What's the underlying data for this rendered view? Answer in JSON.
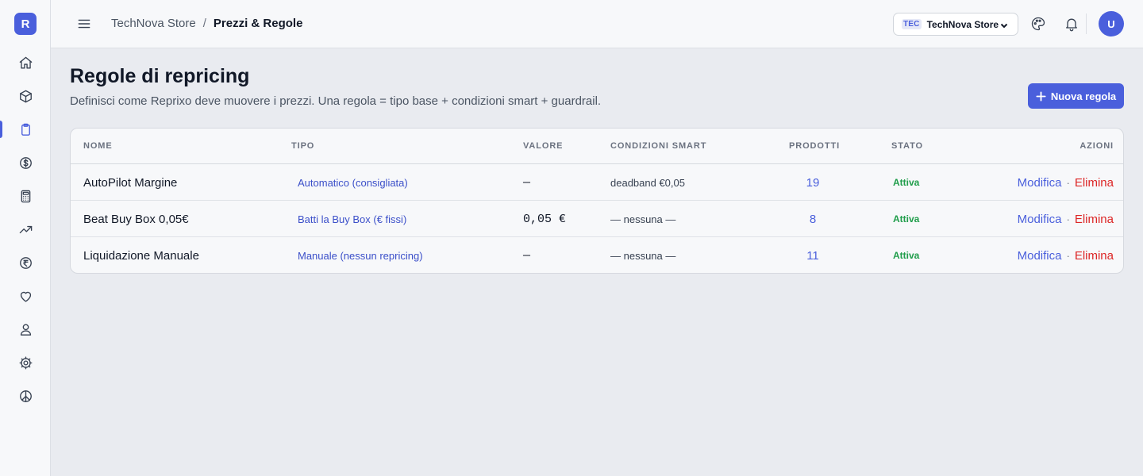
{
  "app": {
    "logo_letter": "R"
  },
  "sidebar": {
    "items": [
      {
        "name": "home-icon",
        "active": false
      },
      {
        "name": "box-icon",
        "active": false
      },
      {
        "name": "clipboard-icon",
        "active": true
      },
      {
        "name": "dollar-icon",
        "active": false
      },
      {
        "name": "calculator-icon",
        "active": false
      },
      {
        "name": "trending-up-icon",
        "active": false
      },
      {
        "name": "rupee-icon",
        "active": false
      },
      {
        "name": "heart-icon",
        "active": false
      },
      {
        "name": "user-icon",
        "active": false
      },
      {
        "name": "gear-icon",
        "active": false
      },
      {
        "name": "peace-icon",
        "active": false
      }
    ]
  },
  "header": {
    "breadcrumb": {
      "parent": "TechNova Store",
      "separator": "/",
      "current": "Prezzi & Regole"
    },
    "store_select": {
      "badge": "TEC",
      "name": "TechNova Store"
    },
    "avatar_initial": "U"
  },
  "main": {
    "title": "Regole di repricing",
    "subtitle": "Definisci come Reprixo deve muovere i prezzi. Una regola = tipo base + condizioni smart + guardrail.",
    "new_button_label": "Nuova regola",
    "table": {
      "columns": {
        "name": "NOME",
        "type": "TIPO",
        "value": "VALORE",
        "conditions": "CONDIZIONI SMART",
        "products": "PRODOTTI",
        "status": "STATO",
        "actions": "AZIONI"
      },
      "rows": [
        {
          "name": "AutoPilot Margine",
          "type": "Automatico (consigliata)",
          "value": "—",
          "conditions": "deadband €0,05",
          "products": "19",
          "status": "Attiva",
          "edit": "Modifica",
          "delete": "Elimina"
        },
        {
          "name": "Beat Buy Box 0,05€",
          "type": "Batti la Buy Box (€ fissi)",
          "value": "0,05 €",
          "conditions": "— nessuna —",
          "products": "8",
          "status": "Attiva",
          "edit": "Modifica",
          "delete": "Elimina"
        },
        {
          "name": "Liquidazione Manuale",
          "type": "Manuale (nessun repricing)",
          "value": "—",
          "conditions": "— nessuna —",
          "products": "11",
          "status": "Attiva",
          "edit": "Modifica",
          "delete": "Elimina"
        }
      ],
      "action_separator": "·"
    }
  },
  "colors": {
    "accent": "#4a5fdc",
    "active_status": "#1f9d4a",
    "danger": "#dc2626"
  }
}
